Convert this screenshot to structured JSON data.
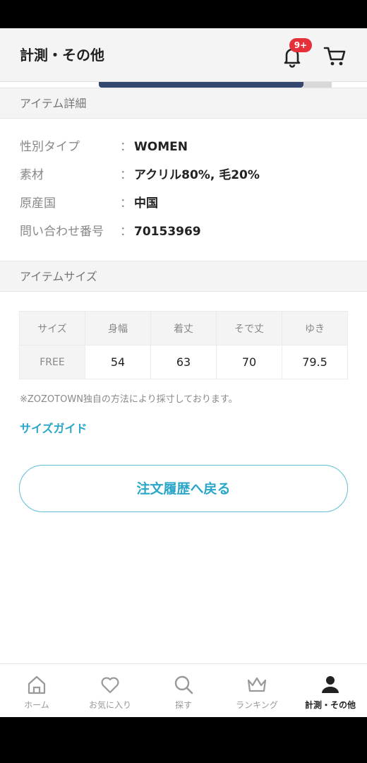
{
  "header": {
    "title": "計測・その他",
    "notification_badge": "9+"
  },
  "item_details": {
    "section_title": "アイテム詳細",
    "colon": "：",
    "rows": [
      {
        "label": "性別タイプ",
        "value": "WOMEN"
      },
      {
        "label": "素材",
        "value": "アクリル80%, 毛20%"
      },
      {
        "label": "原産国",
        "value": "中国"
      },
      {
        "label": "問い合わせ番号",
        "value": "70153969"
      }
    ]
  },
  "item_size": {
    "section_title": "アイテムサイズ",
    "columns": [
      "サイズ",
      "身幅",
      "着丈",
      "そで丈",
      "ゆき"
    ],
    "rows": [
      [
        "FREE",
        "54",
        "63",
        "70",
        "79.5"
      ]
    ],
    "note": "※ZOZOTOWN独自の方法により採寸しております。",
    "size_guide_link": "サイズガイド"
  },
  "back_button_label": "注文履歴へ戻る",
  "bottom_nav": [
    {
      "label": "ホーム",
      "icon": "home-icon"
    },
    {
      "label": "お気に入り",
      "icon": "heart-icon"
    },
    {
      "label": "探す",
      "icon": "search-icon"
    },
    {
      "label": "ランキング",
      "icon": "crown-icon"
    },
    {
      "label": "計測・その他",
      "icon": "person-icon",
      "active": true
    }
  ],
  "colors": {
    "accent": "#2aa6c9",
    "badge": "#e5303a",
    "band": "#f4f4f4"
  }
}
